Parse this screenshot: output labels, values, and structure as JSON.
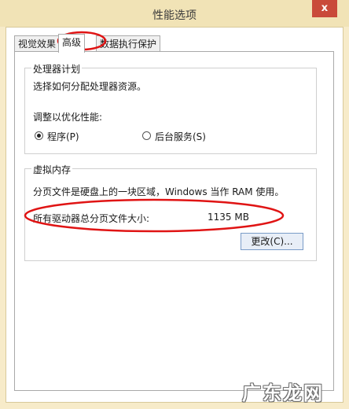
{
  "window": {
    "title": "性能选项",
    "close_label": "x"
  },
  "tabs": [
    {
      "label": "视觉效果"
    },
    {
      "label": "高级"
    },
    {
      "label": "数据执行保护"
    }
  ],
  "processor_group": {
    "title": "处理器计划",
    "description": "选择如何分配处理器资源。",
    "prompt": "调整以优化性能:",
    "options": [
      {
        "label": "程序(P)",
        "selected": true
      },
      {
        "label": "后台服务(S)",
        "selected": false
      }
    ]
  },
  "memory_group": {
    "title": "虚拟内存",
    "description": "分页文件是硬盘上的一块区域，Windows 当作 RAM 使用。",
    "total_label": "所有驱动器总分页文件大小:",
    "total_value": "1135 MB",
    "change_button": "更改(C)..."
  },
  "annotations": {
    "color": "#e01414"
  },
  "watermark": {
    "text": "广东龙网"
  }
}
